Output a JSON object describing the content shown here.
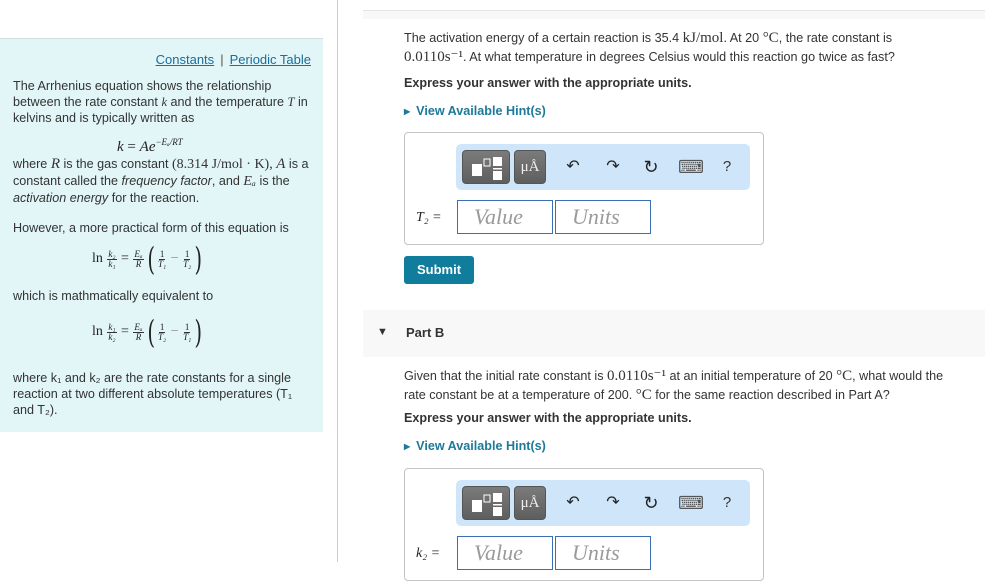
{
  "sidebar": {
    "links": {
      "constants": "Constants",
      "separator": "|",
      "periodic_table": "Periodic Table"
    },
    "intro": "The Arrhenius equation shows the relationship between the rate constant",
    "intro_var_k": "k",
    "intro_mid": "and the temperature",
    "intro_var_T": "T",
    "intro_end": "in kelvins and is typically written as",
    "eq1": {
      "lhs": "k",
      "eq": "=",
      "A": "A",
      "e": "e",
      "exp": "−Eₐ/RT"
    },
    "where1_a": "where",
    "where1_R": "R",
    "where1_b": "is the gas constant",
    "where1_R_value": "(8.314 J/mol · K),",
    "where1_A": "A",
    "where1_c": "is a constant called the",
    "frequency_factor": "frequency factor",
    "where1_d": ", and",
    "where1_Ea": "Eₐ",
    "where1_e": "is the",
    "activation_energy": "activation energy",
    "where1_f": "for the reaction.",
    "practical": "However, a more practical form of this equation is",
    "eq2": {
      "ln": "ln",
      "k_num": "k₂",
      "k_den": "k₁",
      "eq": "=",
      "ea_num": "Eₐ",
      "ea_den": "R",
      "one": "1",
      "t_a": "T₁",
      "minus": "−",
      "t_b": "T₂"
    },
    "equivalent": "which is mathmatically equivalent to",
    "eq3": {
      "ln": "ln",
      "k_num": "k₁",
      "k_den": "k₂",
      "eq": "=",
      "ea_num": "Eₐ",
      "ea_den": "R",
      "one": "1",
      "t_a": "T₂",
      "minus": "−",
      "t_b": "T₁"
    },
    "where2": "where k₁ and k₂ are the rate constants for a single reaction at two different absolute temperatures (T₁ and T₂)."
  },
  "part_a": {
    "question_line1_a": "The activation energy of a certain reaction is 35.4",
    "question_line1_unit": "kJ/mol",
    "question_line1_b": ". At 20",
    "question_line1_deg": "°C",
    "question_line1_c": ", the rate constant is",
    "question_line2_val": "0.0110s⁻¹",
    "question_line2_b": ". At what temperature in degrees Celsius would this reaction go twice as fast?",
    "instruction": "Express your answer with the appropriate units.",
    "hint_label": "View Available Hint(s)",
    "variable_label": "T₂ =",
    "value_placeholder": "Value",
    "units_placeholder": "Units",
    "submit_label": "Submit"
  },
  "part_b": {
    "title": "Part B",
    "question_line1_a": "Given that the initial rate constant is",
    "question_line1_val": "0.0110s⁻¹",
    "question_line1_b": "at an initial temperature of 20",
    "question_line1_deg": "°C",
    "question_line1_c": ", what would the",
    "question_line2_a": "rate constant be at a temperature of 200.",
    "question_line2_deg": "°C",
    "question_line2_b": "for the same reaction described in Part A?",
    "instruction": "Express your answer with the appropriate units.",
    "hint_label": "View Available Hint(s)",
    "variable_label": "k₂ =",
    "value_placeholder": "Value",
    "units_placeholder": "Units"
  },
  "toolbar": {
    "templates_icon": "templates-icon",
    "units_label": "μÅ",
    "undo_glyph": "↶",
    "redo_glyph": "↷",
    "reset_glyph": "↻",
    "keyboard_glyph": "⌨",
    "help_glyph": "?"
  },
  "colors": {
    "panel_bg": "#e2f5f7",
    "link": "#1d6d9a",
    "hint": "#1d7a99",
    "submit": "#0f7d9b",
    "toolbar_bg": "#cfe6fa",
    "field_border": "#3a6fb3"
  }
}
